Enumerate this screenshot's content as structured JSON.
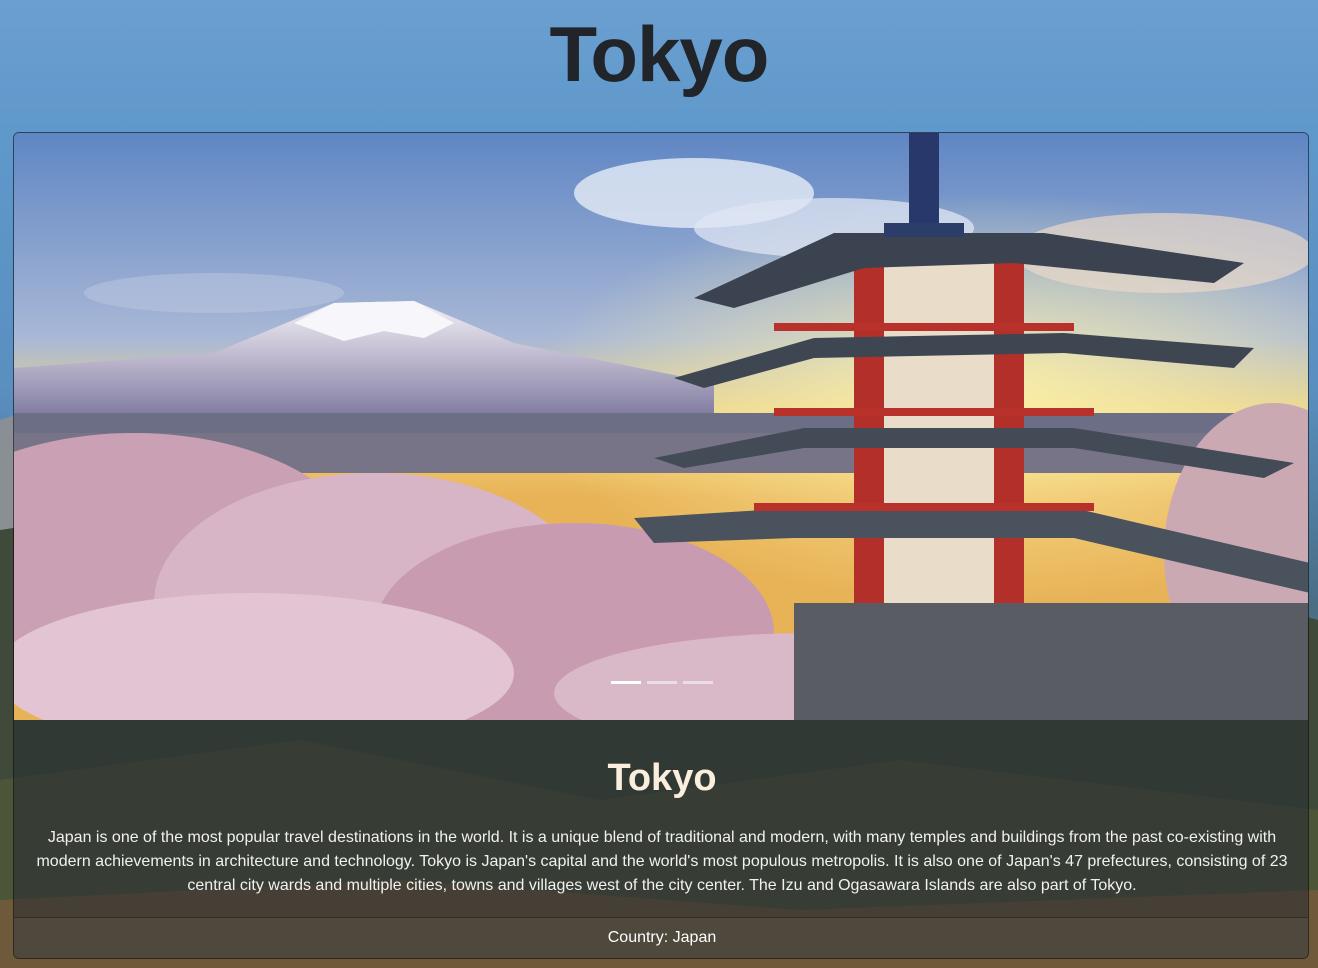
{
  "page": {
    "title": "Tokyo"
  },
  "carousel": {
    "slides": 3,
    "active_index": 0,
    "image_description": "Chureito Pagoda with cherry blossoms and Mount Fuji at sunset"
  },
  "card": {
    "title": "Tokyo",
    "text": "Japan is one of the most popular travel destinations in the world. It is a unique blend of traditional and modern, with many temples and buildings from the past co-existing with modern achievements in architecture and technology. Tokyo is Japan's capital and the world's most populous metropolis. It is also one of Japan's 47 prefectures, consisting of 23 central city wards and multiple cities, towns and villages west of the city center. The Izu and Ogasawara Islands are also part of Tokyo.",
    "footer": "Country: Japan"
  },
  "colors": {
    "title_text": "#212529",
    "card_title": "#fbeedd",
    "sky_top": "#6b9fd0"
  }
}
